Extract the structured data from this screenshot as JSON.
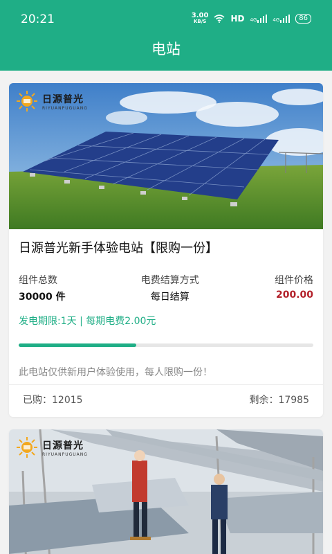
{
  "status_bar": {
    "time": "20:21",
    "net_speed": "3.00",
    "net_unit": "KB/S",
    "hd": "HD",
    "signal_1": "4G",
    "signal_2": "4G",
    "battery": "86"
  },
  "header": {
    "title": "电站"
  },
  "cards": [
    {
      "logo_name": "日源普光",
      "logo_sub": "RIYUANPUGUANG",
      "title": "日源普光新手体验电站【限购一份】",
      "stats": [
        {
          "label": "组件总数",
          "value": "30000 件"
        },
        {
          "label": "电费结算方式",
          "value": "每日结算"
        },
        {
          "label": "组件价格",
          "value": "200.00"
        }
      ],
      "period": "发电期限:1天 | 每期电费2.00元",
      "progress": 0.4,
      "description": "此电站仅供新用户体验使用，每人限购一份！",
      "purchased": "已购：12015",
      "remaining": "剩余：17985"
    },
    {
      "logo_name": "日源普光",
      "logo_sub": "RIYUANPUGUANG"
    }
  ],
  "colors": {
    "primary": "#1fae86",
    "price": "#b3212a"
  }
}
